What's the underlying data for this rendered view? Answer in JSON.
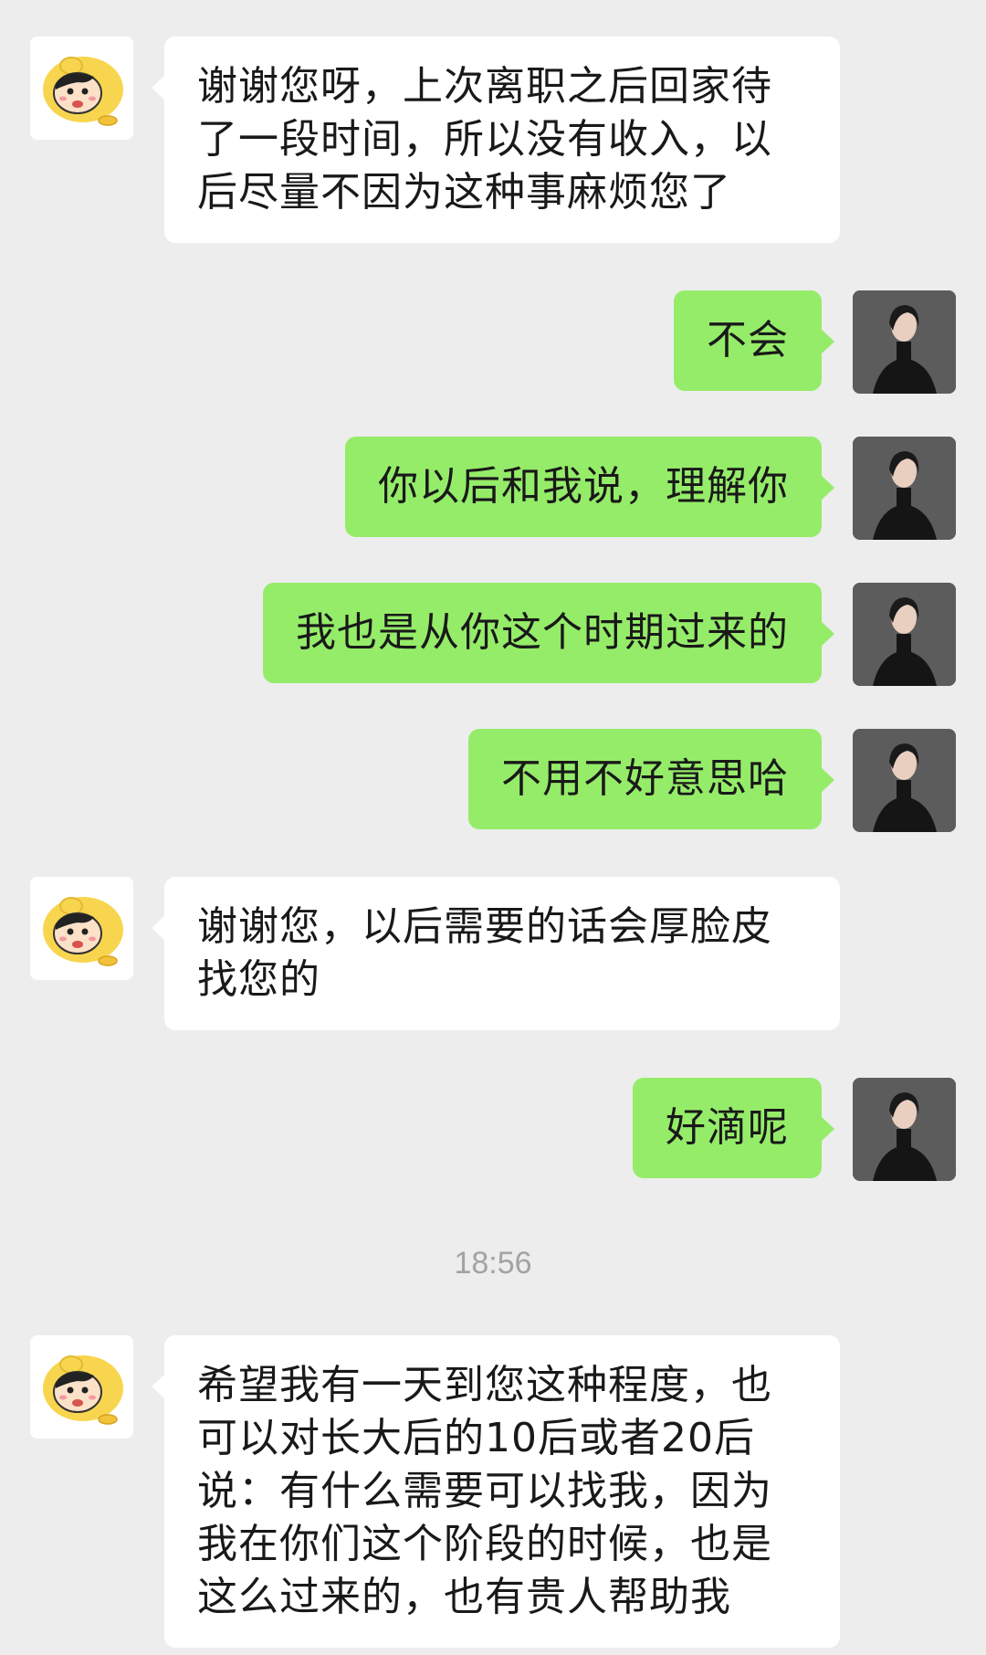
{
  "messages": [
    {
      "side": "left",
      "text": "谢谢您呀，上次离职之后回家待了一段时间，所以没有收入，以后尽量不因为这种事麻烦您了"
    },
    {
      "side": "right",
      "text": "不会"
    },
    {
      "side": "right",
      "text": "你以后和我说，理解你"
    },
    {
      "side": "right",
      "text": "我也是从你这个时期过来的"
    },
    {
      "side": "right",
      "text": "不用不好意思哈"
    },
    {
      "side": "left",
      "text": "谢谢您，以后需要的话会厚脸皮找您的"
    },
    {
      "side": "right",
      "text": "好滴呢"
    },
    {
      "side": "left",
      "text": "希望我有一天到您这种程度，也可以对长大后的10后或者20后说：有什么需要可以找我，因为我在你们这个阶段的时候，也是这么过来的，也有贵人帮助我"
    }
  ],
  "timestamp": "18:56",
  "colors": {
    "background": "#ededed",
    "incoming_bubble": "#ffffff",
    "outgoing_bubble": "#95ec69",
    "text": "#191919",
    "timestamp": "#a3a3a3"
  },
  "avatars": {
    "left": "cartoon-boy-avatar",
    "right": "woman-photo-avatar"
  }
}
